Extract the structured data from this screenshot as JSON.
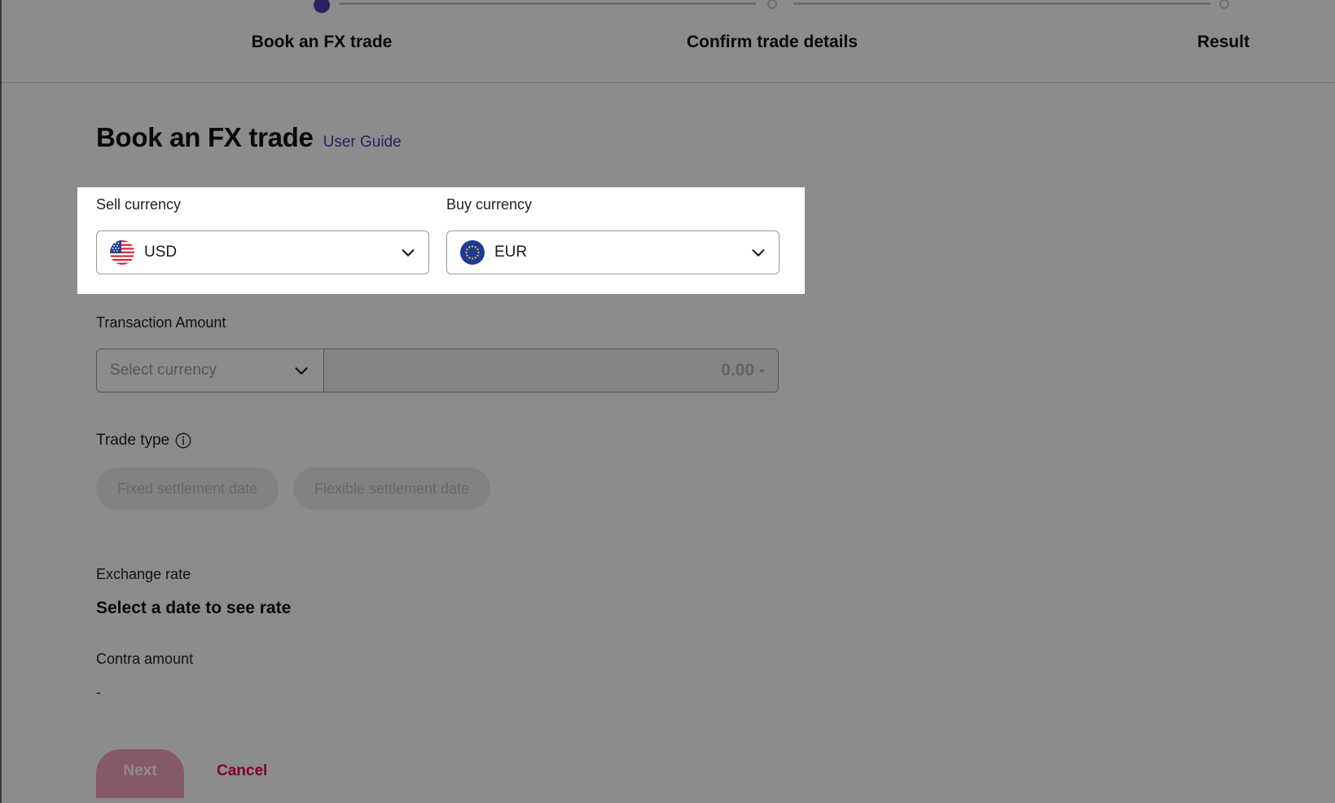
{
  "stepper": {
    "steps": [
      {
        "label": "Book an FX trade",
        "state": "active"
      },
      {
        "label": "Confirm trade details",
        "state": "pending"
      },
      {
        "label": "Result",
        "state": "pending"
      }
    ]
  },
  "page": {
    "title": "Book an FX trade",
    "user_guide_link": "User Guide"
  },
  "sell_currency": {
    "label": "Sell currency",
    "value": "USD",
    "flag_icon": "us-flag-icon"
  },
  "buy_currency": {
    "label": "Buy currency",
    "value": "EUR",
    "flag_icon": "eu-flag-icon"
  },
  "transaction_amount": {
    "label": "Transaction Amount",
    "currency_placeholder": "Select currency",
    "amount_placeholder": "0.00 -"
  },
  "trade_type": {
    "label": "Trade type",
    "options": [
      "Fixed settlement date",
      "Flexible settlement date"
    ]
  },
  "exchange_rate": {
    "label": "Exchange rate",
    "value": "Select a date to see rate"
  },
  "contra_amount": {
    "label": "Contra amount",
    "value": "-"
  },
  "actions": {
    "next_label": "Next",
    "cancel_label": "Cancel"
  },
  "colors": {
    "accent": "#4b3fb0",
    "cancel": "#e6004c",
    "next_disabled": "#f4a0c0"
  }
}
